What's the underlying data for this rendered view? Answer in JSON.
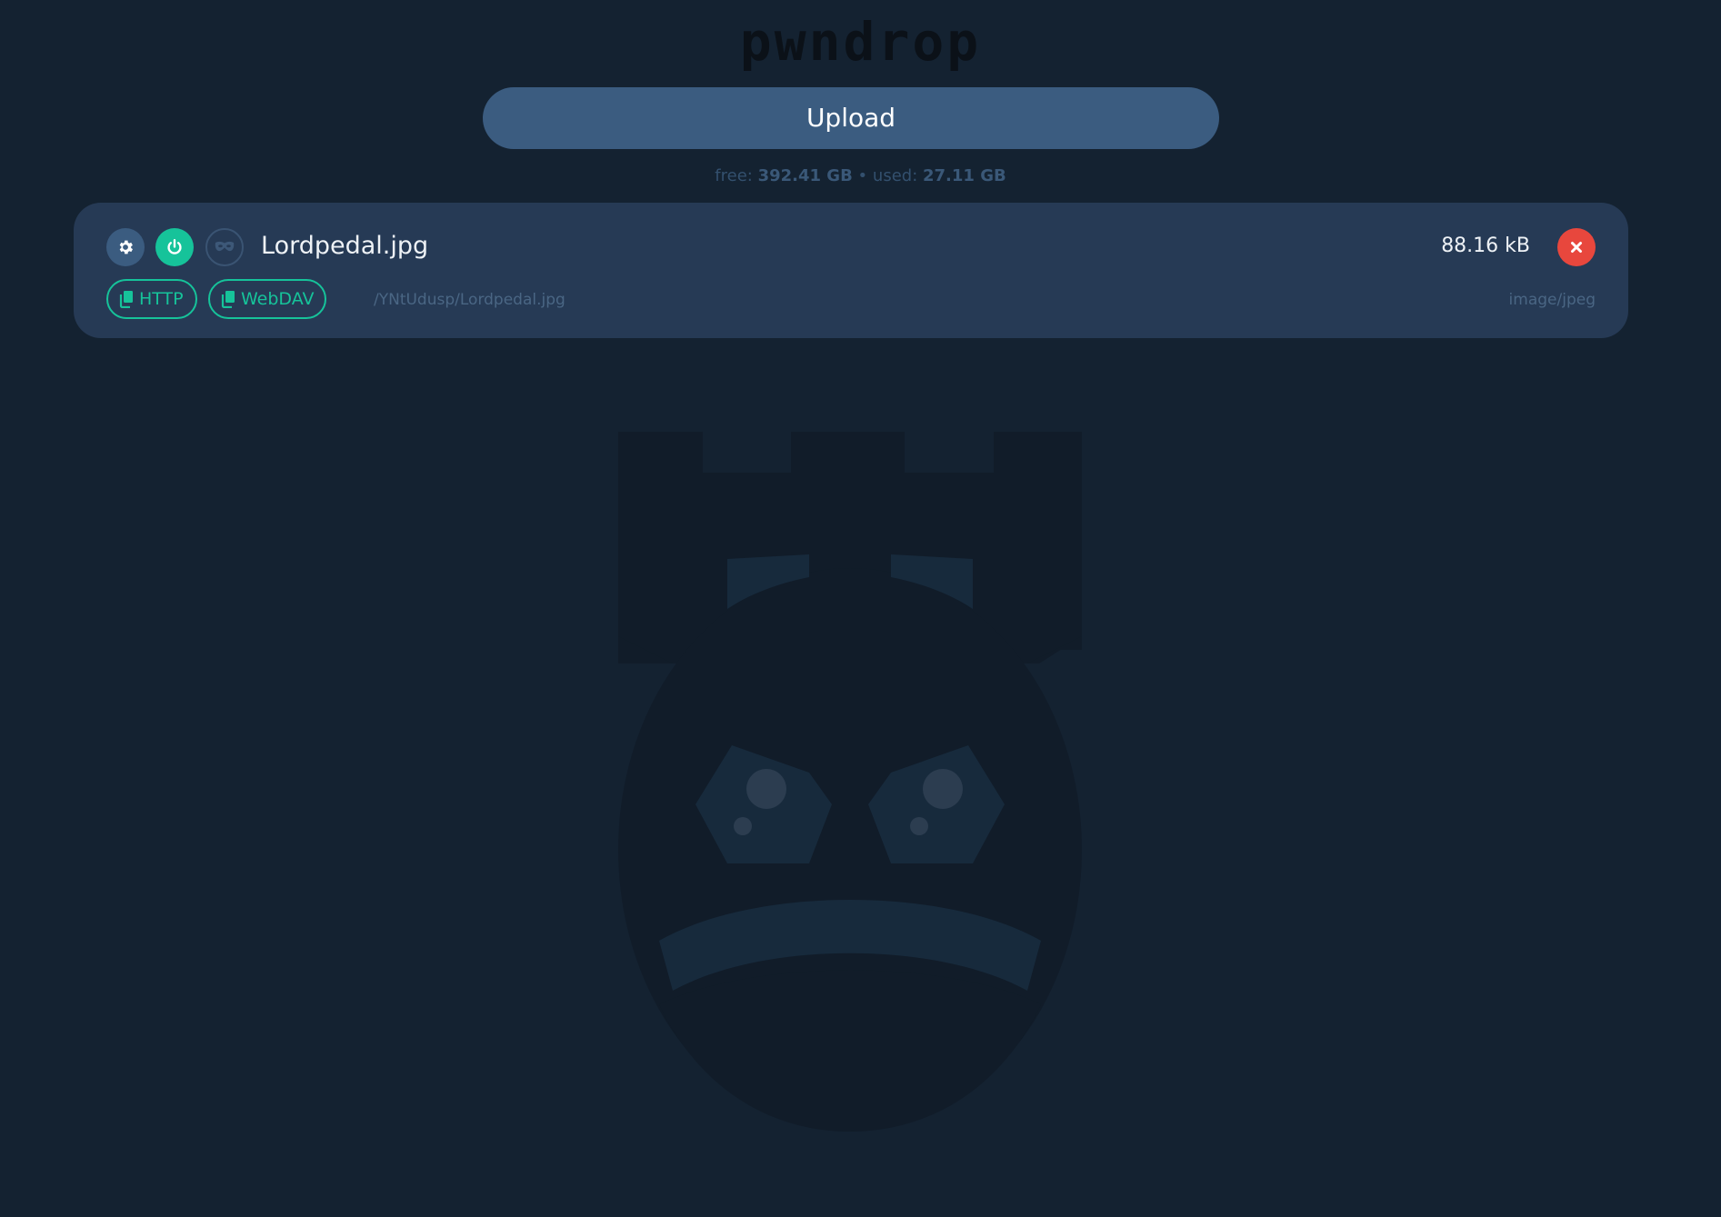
{
  "app": {
    "logo_text": "pwndrop"
  },
  "upload": {
    "label": "Upload"
  },
  "storage": {
    "free_label": "free:",
    "free_value": "392.41 GB",
    "separator": "•",
    "used_label": "used:",
    "used_value": "27.11 GB"
  },
  "files": [
    {
      "name": "Lordpedal.jpg",
      "size": "88.16 kB",
      "path": "/YNtUdusp/Lordpedal.jpg",
      "mime": "image/jpeg",
      "enabled": true,
      "links": {
        "http_label": "HTTP",
        "webdav_label": "WebDAV"
      },
      "icons": {
        "settings": "gear-icon",
        "power": "power-icon",
        "facade": "mask-icon",
        "delete": "close-icon",
        "copy": "copy-icon"
      }
    }
  ],
  "colors": {
    "background": "#142231",
    "card": "#263a55",
    "upload_button": "#3b5c80",
    "accent_green": "#16c39a",
    "delete_red": "#e8473d",
    "muted_text": "#4a6684"
  }
}
